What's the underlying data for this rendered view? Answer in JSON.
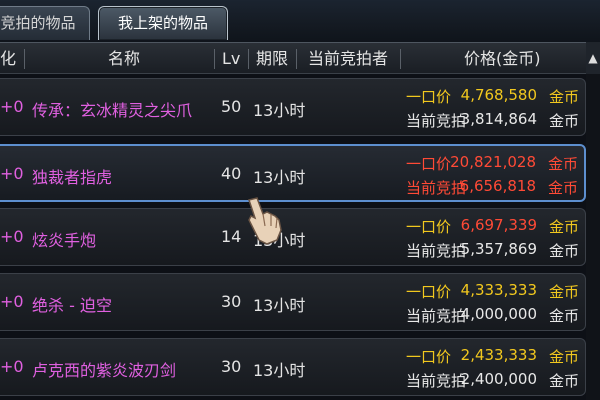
{
  "tabs": [
    {
      "label": "竞拍的物品"
    },
    {
      "label": "我上架的物品"
    }
  ],
  "header": {
    "col_enh": "化",
    "col_name": "名称",
    "col_lv": "Lv",
    "col_duration": "期限",
    "col_bidder": "当前竞拍者",
    "col_price": "价格(金币)"
  },
  "scroll": {
    "up_icon": "▲"
  },
  "rows": [
    {
      "enhance": "+0",
      "name": "传承：玄冰精灵之尖爪",
      "lv": "50",
      "duration": "13小时",
      "buyout_label": "一口价",
      "buyout": "4,768,580",
      "buyout_currency": "金币",
      "bid_label": "当前竞拍",
      "bid": "3,814,864",
      "bid_currency": "金币"
    },
    {
      "enhance": "+0",
      "name": "独裁者指虎",
      "lv": "40",
      "duration": "13小时",
      "buyout_label": "一口价",
      "buyout": "20,821,028",
      "buyout_currency": "金币",
      "bid_label": "当前竞拍",
      "bid": "6,656,818",
      "bid_currency": "金币"
    },
    {
      "enhance": "+0",
      "name": "炫炎手炮",
      "lv": "14",
      "duration": "13小时",
      "buyout_label": "一口价",
      "buyout": "6,697,339",
      "buyout_currency": "金币",
      "bid_label": "当前竞拍",
      "bid": "5,357,869",
      "bid_currency": "金币"
    },
    {
      "enhance": "+0",
      "name": "绝杀 - 迫空",
      "lv": "30",
      "duration": "13小时",
      "buyout_label": "一口价",
      "buyout": "4,333,333",
      "buyout_currency": "金币",
      "bid_label": "当前竞拍",
      "bid": "4,000,000",
      "bid_currency": "金币"
    },
    {
      "enhance": "+0",
      "name": "卢克西的紫炎波刃剑",
      "lv": "30",
      "duration": "13小时",
      "buyout_label": "一口价",
      "buyout": "2,433,333",
      "buyout_currency": "金币",
      "bid_label": "当前竞拍",
      "bid": "2,400,000",
      "bid_currency": "金币"
    }
  ]
}
